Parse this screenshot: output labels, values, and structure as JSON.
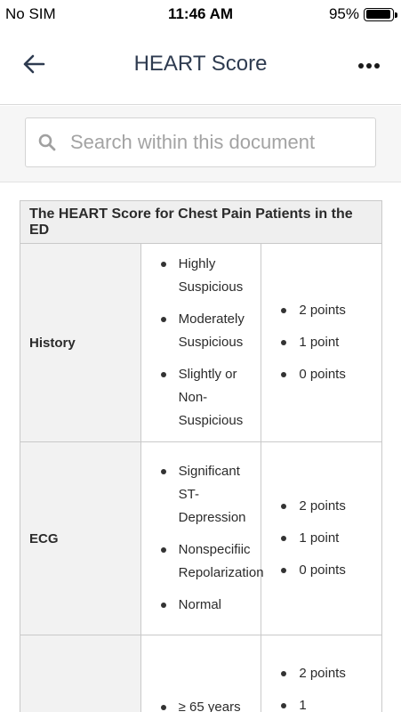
{
  "status_bar": {
    "carrier": "No SIM",
    "time": "11:46 AM",
    "battery_percent": "95%",
    "battery_level": 0.95
  },
  "nav": {
    "title": "HEART Score",
    "back_icon": "arrow-left-icon",
    "more_icon": "more-dots-icon"
  },
  "search": {
    "placeholder": "Search within this document",
    "value": "",
    "icon": "search-icon"
  },
  "table": {
    "caption": "The HEART Score for Chest Pain Patients in the ED",
    "rows": [
      {
        "label": "History",
        "items": [
          "Highly Suspicious",
          "Moderately Suspicious",
          "Slightly or Non-Suspicious"
        ],
        "points": [
          "2 points",
          "1 point",
          "0 points"
        ]
      },
      {
        "label": "ECG",
        "items": [
          "Significant ST-Depression",
          "Nonspecifiic Repolarization",
          "Normal"
        ],
        "points": [
          "2 points",
          "1 point",
          "0 points"
        ]
      },
      {
        "label": "",
        "items": [
          "≥ 65 years"
        ],
        "points": [
          "2 points",
          "1"
        ]
      }
    ]
  },
  "colors": {
    "title_text": "#2e3b50",
    "header_bg": "#efefef",
    "search_bg": "#f6f6f6"
  }
}
